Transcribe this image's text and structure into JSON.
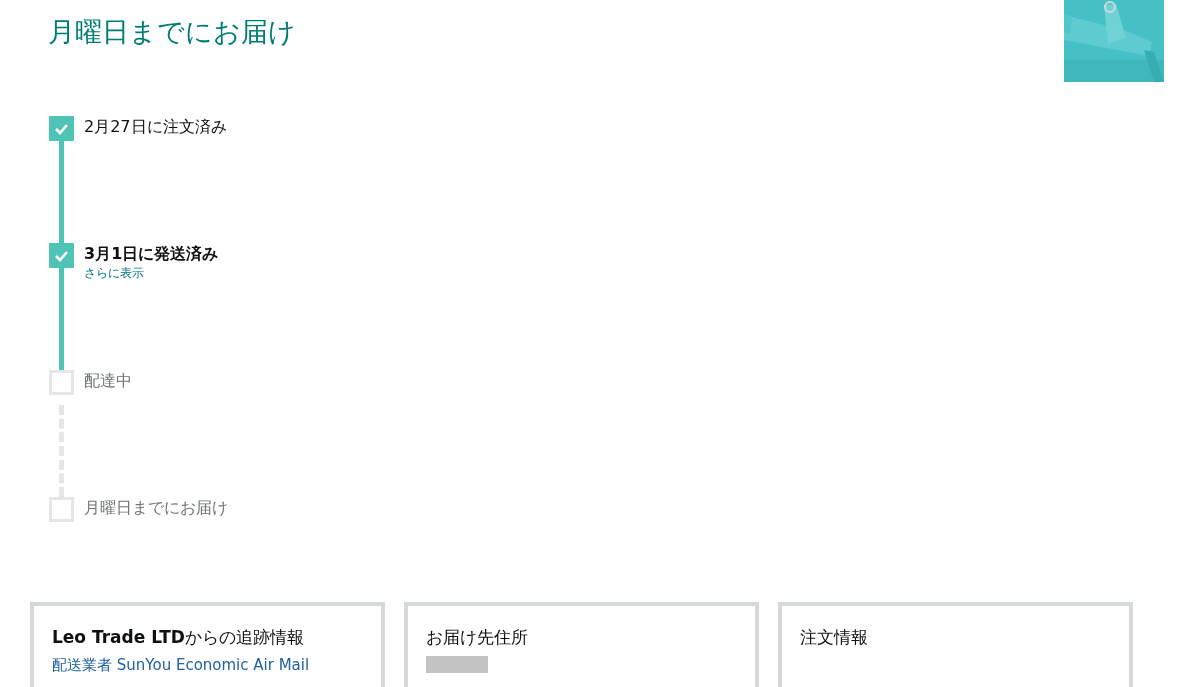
{
  "title": "月曜日までにお届け",
  "steps": [
    {
      "label": "2月27日に注文済み",
      "done": true,
      "current": false
    },
    {
      "label": "3月1日に発送済み",
      "done": true,
      "current": true,
      "link": "さらに表示"
    },
    {
      "label": "配達中",
      "done": false,
      "current": false
    },
    {
      "label": "月曜日までにお届け",
      "done": false,
      "current": false
    }
  ],
  "cards": [
    {
      "kind": "tracking",
      "title": "**Leo Trade LTD**からの追跡情報",
      "link": "配送業者 SunYou Economic Air Mail"
    },
    {
      "kind": "address",
      "title": "お届け先住所"
    },
    {
      "kind": "order",
      "title": "注文情報"
    }
  ]
}
